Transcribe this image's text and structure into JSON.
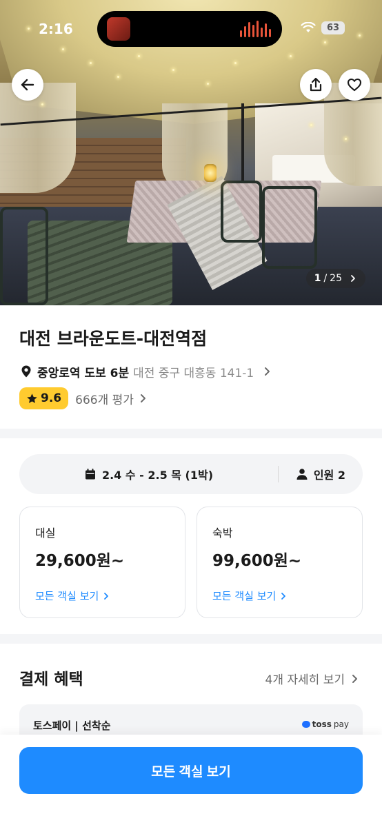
{
  "status_bar": {
    "time": "2:16",
    "battery": "63"
  },
  "gallery": {
    "current": "1",
    "total": "25"
  },
  "property": {
    "name": "대전 브라운도트-대전역점",
    "station": "중앙로역 도보 6분",
    "address": "대전 중구 대흥동 141-1",
    "rating": "9.6",
    "reviews": "666개 평가"
  },
  "booking": {
    "dates": "2.4 수 - 2.5 목 (1박)",
    "guests": "인원 2"
  },
  "stays": [
    {
      "kind": "대실",
      "price": "29,600원~",
      "link": "모든 객실 보기"
    },
    {
      "kind": "숙박",
      "price": "99,600원~",
      "link": "모든 객실 보기"
    }
  ],
  "benefits": {
    "title": "결제 혜택",
    "more": "4개 자세히 보기",
    "card_name": "토스페이 | 선착순",
    "card_brand_main": "toss",
    "card_brand_sub": "pay"
  },
  "cta": {
    "label": "모든 객실 보기"
  },
  "colors": {
    "accent": "#1e8bff",
    "rating_badge": "#ffcb2f"
  },
  "icons": [
    "back-arrow-icon",
    "share-icon",
    "heart-icon",
    "location-pin-icon",
    "star-icon",
    "calendar-icon",
    "person-icon",
    "chevron-right-icon",
    "wifi-icon"
  ]
}
